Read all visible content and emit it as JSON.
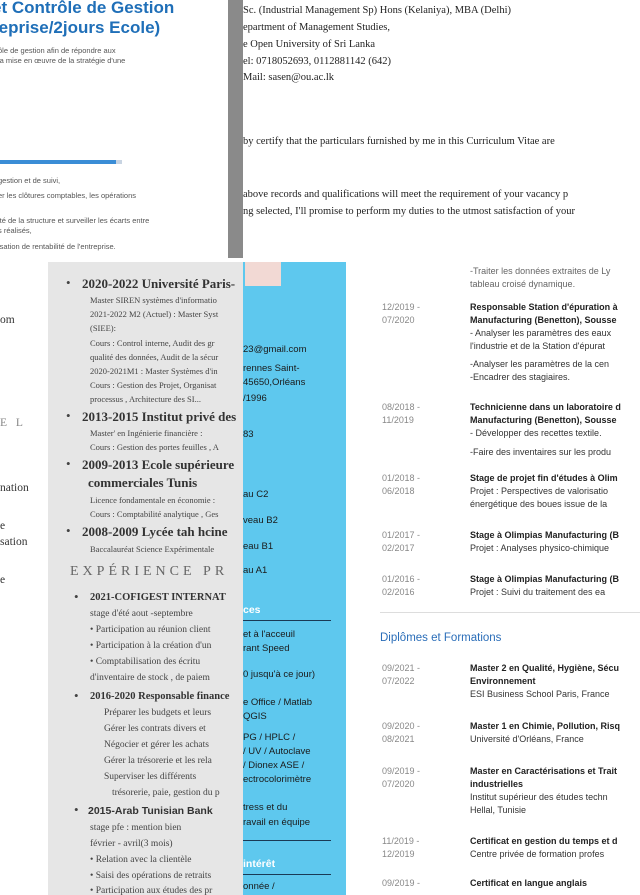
{
  "fragA": {
    "title_line1": "et Contrôle de Gestion",
    "title_line2": "reprise/2jours Ecole)",
    "intro1": "ôle de gestion afin de répondre aux",
    "intro2": "la mise en œuvre de la stratégie d'une",
    "l1": "gestion et de suivi,",
    "l2": "er les clôtures comptables, les opérations",
    "l3": "ité de la structure et surveiller les écarts entre",
    "l4": "s réalisés,",
    "l5": "isation de rentabilité de l'entreprise.",
    "skill_level": 0.95
  },
  "fragB": {
    "l1": "Sc. (Industrial Management Sp) Hons (Kelaniya), MBA (Delhi)",
    "l2": "epartment of Management Studies,",
    "l3": "e Open University of Sri Lanka",
    "l4": "el: 0718052693, 0112881142 (642)",
    "l5": "Mail: sasen@ou.ac.lk",
    "l6": "by certify that the particulars furnished by me in this Curriculum Vitae are",
    "l7": "above records and qualifications will meet the requirement of your vacancy p",
    "l8": "ng selected, I'll promise to perform my duties to the utmost satisfaction of your"
  },
  "fragC": {
    "l1": "om",
    "l2": "E L",
    "l3": "nation",
    "l4": "e",
    "l5": "sation",
    "l6": "e"
  },
  "fragD": {
    "e1_title": "2020-2022 Université Paris-",
    "e1_l1": "Master SIREN systèmes d'informatio",
    "e1_l2": "2021-2022 M2 (Actuel) : Master Syst",
    "e1_l3": "(SIEE):",
    "e1_l4": "Cours : Control interne, Audit des gr",
    "e1_l5": "qualité des données, Audit de la sécur",
    "e1_l6": "2020-2021M1 : Master Systèmes d'in",
    "e1_l7": "Cours : Gestion des Projet, Organisat",
    "e1_l8": "processus , Architecture des SI...",
    "e2_title": "2013-2015 Institut privé des",
    "e2_l1": "Master' en Ingénierie financière :",
    "e2_l2": "Cours : Gestion des portes feuilles , A",
    "e3_title": "2009-2013 Ecole supérieure",
    "e3_title2": "commerciales Tunis",
    "e3_l1": "Licence fondamentale en économie :",
    "e3_l2": "Cours : Comptabilité analytique , Ges",
    "e4_title": "2008-2009 Lycée tah hcine",
    "e4_l1": "Baccalauréat Science Expérimentale",
    "section_exp": "EXPÉRIENCE PR",
    "x1_title": "2021-COFIGEST INTERNAT",
    "x1_l1": "stage d'été aout -septembre",
    "x1_l2": "• Participation au réunion client",
    "x1_l3": "• Participation à la création d'un",
    "x1_l4": "• Comptabilisation des écritu",
    "x1_l5": "d'inventaire de stock , de paiem",
    "x2_title": "2016-2020 Responsable finance",
    "x2_l1": "Préparer les budgets et leurs",
    "x2_l2": "Gérer les contrats divers et",
    "x2_l3": "Négocier et gérer les achats",
    "x2_l4": "Gérer la trésorerie et les rela",
    "x2_l5": "Superviser les différents",
    "x2_l6": "trésorerie, paie, gestion du p",
    "x3_title": "2015-Arab Tunisian Bank",
    "x3_l1": "stage pfe : mention bien",
    "x3_l2": "février - avril(3 mois)",
    "x3_l3": "• Relation avec la clientèle",
    "x3_l4": "• Saisi des opérations de retraits",
    "x3_l5": "• Participation aux études des pr"
  },
  "fragE": {
    "l1": "23@gmail.com",
    "l2": "rennes Saint-",
    "l3": "45650,Orléans",
    "l4": "/1996",
    "l5": "83",
    "l6": "au C2",
    "l7": "veau B2",
    "l8": "eau B1",
    "l9": "au A1",
    "sec1": "ces",
    "q1": "et à l'acceuil",
    "q2": "rant Speed",
    "q3": "0 jusqu'à ce jour)",
    "q4": "e Office / Matlab",
    "q5": "QGIS",
    "q6": "PG / HPLC /",
    "q7": "/ UV / Autoclave",
    "q8": "/ Dionex ASE /",
    "q9": "ectrocolorimètre",
    "q10": "tress et du",
    "q11": "ravail en équipe",
    "sec2": "intérêt",
    "q12": "onnée /"
  },
  "fragF": {
    "t0a": "-Traiter les données extraites de Ly",
    "t0b": "tableau croisé dynamique.",
    "d1a": "12/2019 -",
    "d1b": "07/2020",
    "e1a": "Responsable Station d'épuration à",
    "e1b": "Manufacturing (Benetton), Sousse",
    "e1c": "- Analyser les paramètres des eaux",
    "e1d": "l'industrie et de la Station d'épurat",
    "e1e": "-Analyser les paramètres de la cen",
    "e1f": "-Encadrer des stagiaires.",
    "d2a": "08/2018 -",
    "d2b": "11/2019",
    "e2a": "Technicienne dans un laboratoire d",
    "e2b": "Manufacturing (Benetton), Sousse",
    "e2c": "- Développer des recettes textile.",
    "e2d": "-Faire des inventaires sur les produ",
    "d3a": "01/2018 -",
    "d3b": "06/2018",
    "e3a": "Stage de projet fin d'études à Olim",
    "e3b": "Projet : Perspectives de valorisatio",
    "e3c": "énergétique des boues issue de la",
    "d4a": "01/2017 -",
    "d4b": "02/2017",
    "e4a": "Stage à Olimpias Manufacturing (B",
    "e4b": "Projet : Analyses physico-chimique",
    "d5a": "01/2016 -",
    "d5b": "02/2016",
    "e5a": "Stage à Olimpias Manufacturing (B",
    "e5b": "Projet : Suivi du traitement des ea",
    "section": "Diplômes et Formations",
    "g1da": "09/2021 -",
    "g1db": "07/2022",
    "g1a": "Master 2 en Qualité, Hygiène, Sécu",
    "g1b": "Environnement",
    "g1c": "ESI Business School Paris, France",
    "g2da": "09/2020 -",
    "g2db": "08/2021",
    "g2a": "Master 1 en Chimie, Pollution, Risq",
    "g2b": "Université d'Orléans, France",
    "g3da": "09/2019 -",
    "g3db": "07/2020",
    "g3a": "Master en Caractérisations et Trait",
    "g3b": "industrielles",
    "g3c": "Institut supérieur des études techn",
    "g3d": "Hellal, Tunisie",
    "g4da": "11/2019 -",
    "g4db": "12/2019",
    "g4a": "Certificat en gestion du temps et d",
    "g4b": "Centre privée de formation profes",
    "g5da": "09/2019 -",
    "g5a": "Certificat en langue anglais"
  }
}
